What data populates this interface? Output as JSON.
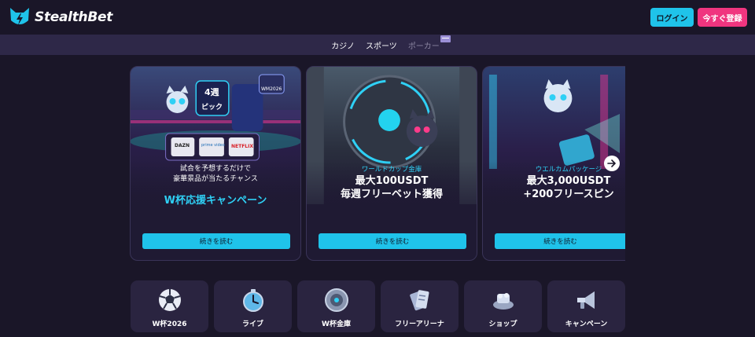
{
  "header": {
    "logo_text": "StealthBet",
    "login_label": "ログイン",
    "register_label": "今すぐ登録"
  },
  "nav": {
    "items": [
      {
        "label": "カジノ"
      },
      {
        "label": "スポーツ"
      },
      {
        "label": "ポーカー"
      }
    ]
  },
  "promos": [
    {
      "image_text": {
        "weeks": "4週",
        "picks": "ピック",
        "badge": "WM2026",
        "logos": [
          "DAZN",
          "prime video",
          "NETFLIX"
        ]
      },
      "subtitle_line1": "試合を予想するだけで",
      "subtitle_line2": "豪華景品が当たるチャンス",
      "title": "W杯応援キャンペーン",
      "button_label": "続きを読む"
    },
    {
      "tag": "ワールドカップ金庫",
      "title_line1": "最大100USDT",
      "title_line2": "毎週フリーベット獲得",
      "button_label": "続きを読む"
    },
    {
      "tag": "ウエルカムパッケージ",
      "title_line1": "最大3,000USDT",
      "title_line2": "+200フリースピン",
      "button_label": "続きを読む"
    }
  ],
  "categories": [
    {
      "label": "W杯2026",
      "icon": "soccer-ball-icon"
    },
    {
      "label": "ライブ",
      "icon": "stopwatch-icon"
    },
    {
      "label": "W杯金庫",
      "icon": "vault-icon"
    },
    {
      "label": "フリーアリーナ",
      "icon": "tickets-icon"
    },
    {
      "label": "ショップ",
      "icon": "shop-icon"
    },
    {
      "label": "キャンペーン",
      "icon": "megaphone-icon"
    }
  ],
  "colors": {
    "background": "#1a1628",
    "accent_cyan": "#1fc3ea",
    "accent_pink": "#f0357f",
    "nav_bg": "#2e2848",
    "tile_bg": "#2a2440"
  }
}
